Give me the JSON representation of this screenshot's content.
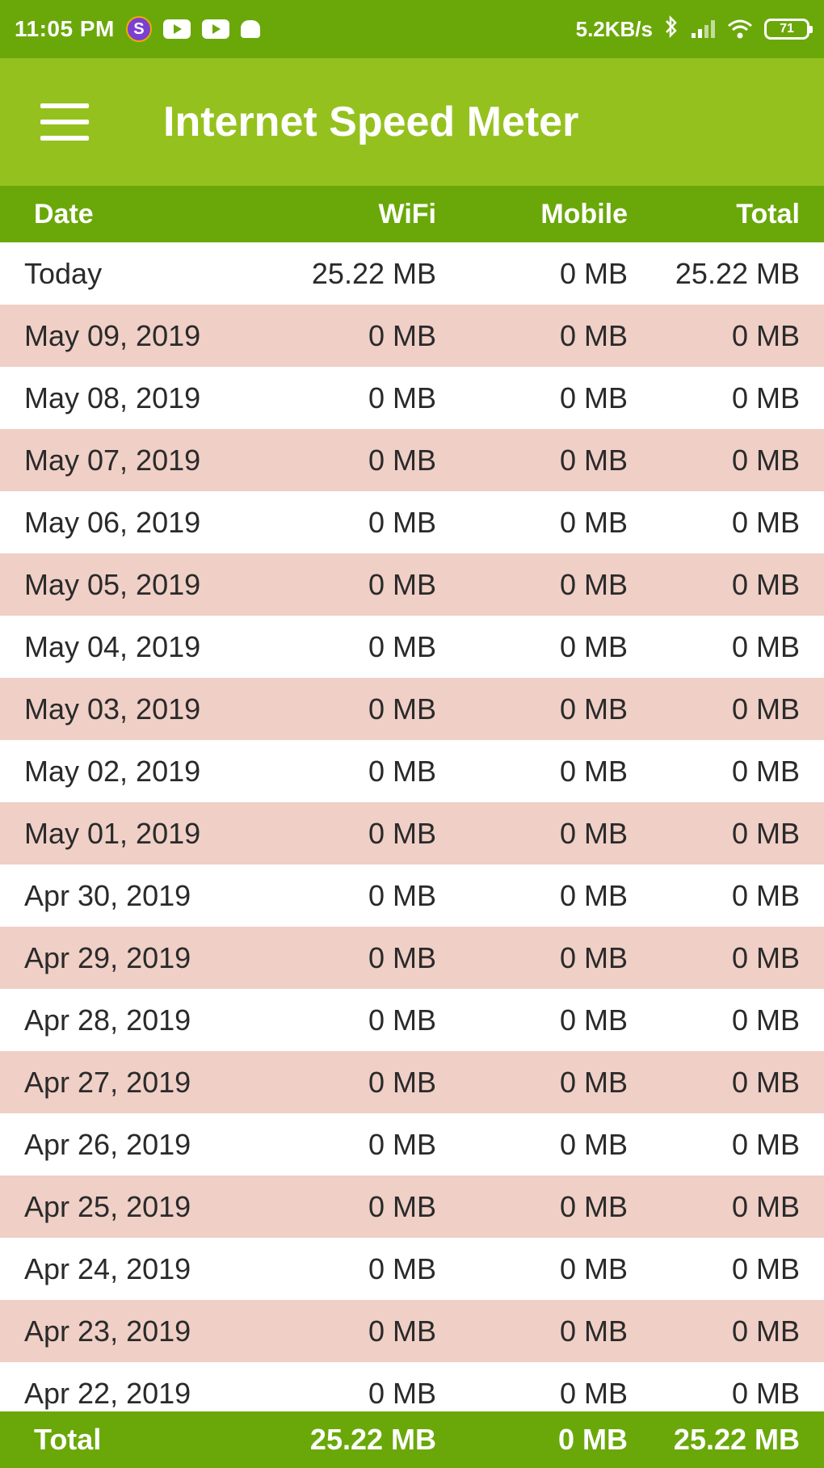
{
  "status_bar": {
    "time": "11:05 PM",
    "app_icon_letter": "S",
    "network_speed": "5.2KB/s",
    "battery_level": "71"
  },
  "app_bar": {
    "title": "Internet Speed Meter",
    "menu_icon": "hamburger-menu-icon"
  },
  "table": {
    "headers": {
      "date": "Date",
      "wifi": "WiFi",
      "mobile": "Mobile",
      "total": "Total"
    },
    "rows": [
      {
        "date": "Today",
        "wifi": "25.22 MB",
        "mobile": "0 MB",
        "total": "25.22 MB"
      },
      {
        "date": "May 09, 2019",
        "wifi": "0 MB",
        "mobile": "0 MB",
        "total": "0 MB"
      },
      {
        "date": "May 08, 2019",
        "wifi": "0 MB",
        "mobile": "0 MB",
        "total": "0 MB"
      },
      {
        "date": "May 07, 2019",
        "wifi": "0 MB",
        "mobile": "0 MB",
        "total": "0 MB"
      },
      {
        "date": "May 06, 2019",
        "wifi": "0 MB",
        "mobile": "0 MB",
        "total": "0 MB"
      },
      {
        "date": "May 05, 2019",
        "wifi": "0 MB",
        "mobile": "0 MB",
        "total": "0 MB"
      },
      {
        "date": "May 04, 2019",
        "wifi": "0 MB",
        "mobile": "0 MB",
        "total": "0 MB"
      },
      {
        "date": "May 03, 2019",
        "wifi": "0 MB",
        "mobile": "0 MB",
        "total": "0 MB"
      },
      {
        "date": "May 02, 2019",
        "wifi": "0 MB",
        "mobile": "0 MB",
        "total": "0 MB"
      },
      {
        "date": "May 01, 2019",
        "wifi": "0 MB",
        "mobile": "0 MB",
        "total": "0 MB"
      },
      {
        "date": "Apr 30, 2019",
        "wifi": "0 MB",
        "mobile": "0 MB",
        "total": "0 MB"
      },
      {
        "date": "Apr 29, 2019",
        "wifi": "0 MB",
        "mobile": "0 MB",
        "total": "0 MB"
      },
      {
        "date": "Apr 28, 2019",
        "wifi": "0 MB",
        "mobile": "0 MB",
        "total": "0 MB"
      },
      {
        "date": "Apr 27, 2019",
        "wifi": "0 MB",
        "mobile": "0 MB",
        "total": "0 MB"
      },
      {
        "date": "Apr 26, 2019",
        "wifi": "0 MB",
        "mobile": "0 MB",
        "total": "0 MB"
      },
      {
        "date": "Apr 25, 2019",
        "wifi": "0 MB",
        "mobile": "0 MB",
        "total": "0 MB"
      },
      {
        "date": "Apr 24, 2019",
        "wifi": "0 MB",
        "mobile": "0 MB",
        "total": "0 MB"
      },
      {
        "date": "Apr 23, 2019",
        "wifi": "0 MB",
        "mobile": "0 MB",
        "total": "0 MB"
      },
      {
        "date": "Apr 22, 2019",
        "wifi": "0 MB",
        "mobile": "0 MB",
        "total": "0 MB"
      }
    ],
    "footer": {
      "label": "Total",
      "wifi": "25.22 MB",
      "mobile": "0 MB",
      "total": "25.22 MB"
    }
  },
  "colors": {
    "status_bar": "#6aa80a",
    "app_bar": "#95c11f",
    "header": "#6aa80a",
    "row_alt": "#efcfc6",
    "row_plain": "#ffffff"
  }
}
